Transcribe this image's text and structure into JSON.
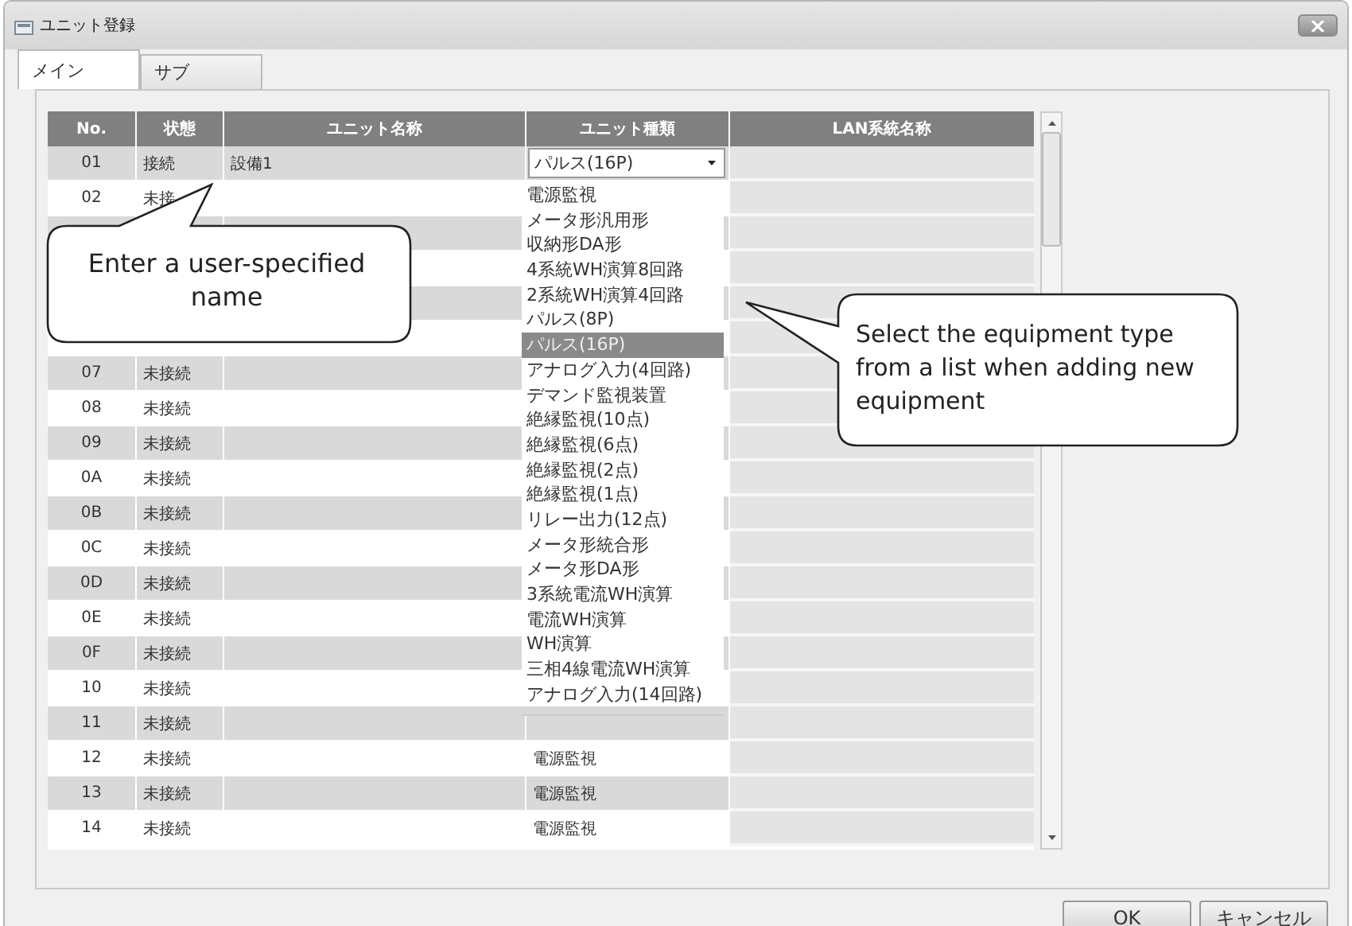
{
  "window": {
    "title": "ユニット登録"
  },
  "tabs": [
    {
      "label": "メイン",
      "selected": true
    },
    {
      "label": "サブ",
      "selected": false
    }
  ],
  "table": {
    "columns": [
      "No.",
      "状態",
      "ユニット名称",
      "ユニット種類",
      "LAN系統名称"
    ],
    "rows": [
      {
        "no": "01",
        "status": "接続",
        "name": "設備1",
        "type": "パルス(16P)",
        "kind": "combo"
      },
      {
        "no": "02",
        "status": "未接"
      },
      {},
      {},
      {},
      {},
      {
        "no": "07",
        "status": "未接続"
      },
      {
        "no": "08",
        "status": "未接続"
      },
      {
        "no": "09",
        "status": "未接続"
      },
      {
        "no": "0A",
        "status": "未接続"
      },
      {
        "no": "0B",
        "status": "未接続"
      },
      {
        "no": "0C",
        "status": "未接続"
      },
      {
        "no": "0D",
        "status": "未接続"
      },
      {
        "no": "0E",
        "status": "未接続"
      },
      {
        "no": "0F",
        "status": "未接続"
      },
      {
        "no": "10",
        "status": "未接続"
      },
      {
        "no": "11",
        "status": "未接続"
      },
      {
        "no": "12",
        "status": "未接続",
        "type": "電源監視",
        "kind": "text"
      },
      {
        "no": "13",
        "status": "未接続",
        "type": "電源監視",
        "kind": "text"
      },
      {
        "no": "14",
        "status": "未接続",
        "type": "電源監視",
        "kind": "text"
      }
    ]
  },
  "dropdown": {
    "items": [
      {
        "label": "電源監視",
        "selected": false
      },
      {
        "label": "メータ形汎用形",
        "selected": false
      },
      {
        "label": "収納形DA形",
        "selected": false
      },
      {
        "label": "4系統WH演算8回路",
        "selected": false
      },
      {
        "label": "2系統WH演算4回路",
        "selected": false
      },
      {
        "label": "パルス(8P)",
        "selected": false
      },
      {
        "label": "パルス(16P)",
        "selected": true
      },
      {
        "label": "アナログ入力(4回路)",
        "selected": false
      },
      {
        "label": "デマンド監視装置",
        "selected": false
      },
      {
        "label": "絶縁監視(10点)",
        "selected": false
      },
      {
        "label": "絶縁監視(6点)",
        "selected": false
      },
      {
        "label": "絶縁監視(2点)",
        "selected": false
      },
      {
        "label": "絶縁監視(1点)",
        "selected": false
      },
      {
        "label": "リレー出力(12点)",
        "selected": false
      },
      {
        "label": "メータ形統合形",
        "selected": false
      },
      {
        "label": "メータ形DA形",
        "selected": false
      },
      {
        "label": "3系統電流WH演算",
        "selected": false
      },
      {
        "label": "電流WH演算",
        "selected": false
      },
      {
        "label": "WH演算",
        "selected": false
      },
      {
        "label": "三相4線電流WH演算",
        "selected": false
      },
      {
        "label": "アナログ入力(14回路)",
        "selected": false
      }
    ]
  },
  "callouts": [
    {
      "text": "Enter a user-specified name"
    },
    {
      "text": "Select the equipment type from a list when adding new equipment"
    }
  ],
  "buttons": [
    {
      "label": "OK"
    },
    {
      "label": "キャンセル"
    }
  ]
}
